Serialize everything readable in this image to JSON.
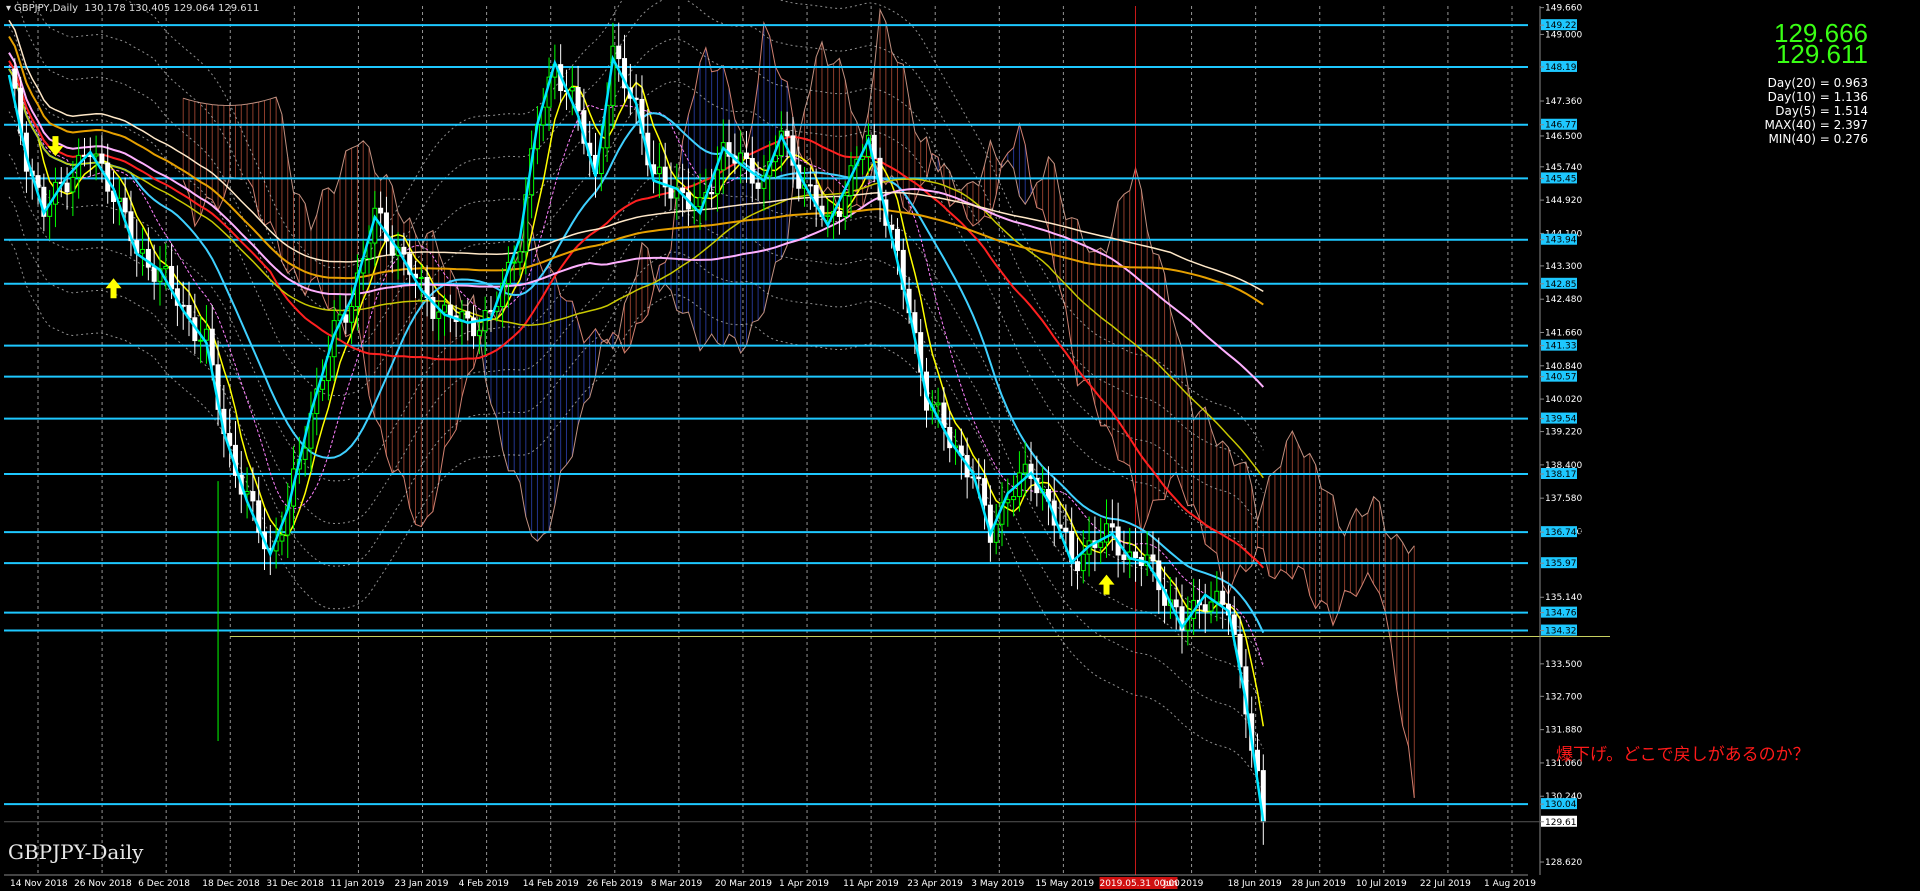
{
  "header": {
    "symbol": "GBPJPY,Daily",
    "ohlc": "130.178 130.405 129.064 129.611"
  },
  "watermark": "GBPJPY-Daily",
  "prices": {
    "bid": "129.666",
    "ask": "129.611"
  },
  "stats": [
    "Day(20) = 0.963",
    "Day(10) = 1.136",
    "Day(5) = 1.514",
    "MAX(40) = 2.397",
    "MIN(40) = 0.276"
  ],
  "annotation": "爆下げ。どこで戻しがあるのか？",
  "colors": {
    "background": "#000000",
    "hline": "#1ec8ff",
    "bull_candle": "#00ff00",
    "bear_candle": "#ffffff",
    "zigzag": "#00e5ff",
    "ma_fast": "#ffff00",
    "ma_red": "#ff2020",
    "ma_cyan": "#3fd0ff",
    "ma_orange": "#e6a000",
    "ma_pink": "#ffb0ff",
    "ma_white": "#ffe8c8",
    "kumo_bear": "#ff7050",
    "kumo_bull": "#4060ff",
    "current_price": "#ffffff",
    "note": "#ff1a1a"
  },
  "chart_data": {
    "type": "candlestick",
    "symbol": "GBPJPY",
    "timeframe": "Daily",
    "ylim": [
      128.3,
      149.7
    ],
    "y_ticks": [
      "149.660",
      "149.228",
      "149.000",
      "148.199",
      "147.360",
      "146.776",
      "146.500",
      "145.740",
      "145.454",
      "144.920",
      "144.100",
      "143.944",
      "143.300",
      "142.859",
      "142.480",
      "141.660",
      "141.336",
      "140.840",
      "140.572",
      "140.020",
      "139.540",
      "139.220",
      "138.400",
      "138.175",
      "137.580",
      "136.760",
      "136.743",
      "135.979",
      "135.140",
      "134.761",
      "134.320",
      "133.500",
      "132.700",
      "131.880",
      "131.060",
      "130.240",
      "130.045",
      "129.611",
      "128.620"
    ],
    "x_ticks": [
      "14 Nov 2018",
      "26 Nov 2018",
      "6 Dec 2018",
      "18 Dec 2018",
      "31 Dec 2018",
      "11 Jan 2019",
      "23 Jan 2019",
      "4 Feb 2019",
      "14 Feb 2019",
      "26 Feb 2019",
      "8 Mar 2019",
      "20 Mar 2019",
      "1 Apr 2019",
      "11 Apr 2019",
      "23 Apr 2019",
      "3 May 2019",
      "15 May 2019",
      "2019.05.31 00:00",
      "Jun 2019",
      "18 Jun 2019",
      "28 Jun 2019",
      "10 Jul 2019",
      "22 Jul 2019",
      "1 Aug 2019"
    ],
    "highlighted_x_tick": "2019.05.31 00:00",
    "horizontal_levels": [
      149.228,
      148.199,
      146.776,
      145.454,
      143.944,
      142.859,
      141.336,
      140.572,
      139.54,
      138.175,
      136.743,
      135.979,
      134.761,
      134.32,
      130.045
    ],
    "current_price": 129.611,
    "price_path": [
      [
        0,
        148.0
      ],
      [
        3,
        146.0
      ],
      [
        6,
        144.6
      ],
      [
        10,
        145.5
      ],
      [
        14,
        146.1
      ],
      [
        18,
        145.2
      ],
      [
        22,
        143.6
      ],
      [
        26,
        143.2
      ],
      [
        30,
        142.2
      ],
      [
        34,
        141.4
      ],
      [
        37,
        139.2
      ],
      [
        41,
        137.5
      ],
      [
        45,
        136.2
      ],
      [
        48,
        137.3
      ],
      [
        52,
        139.7
      ],
      [
        56,
        141.6
      ],
      [
        59,
        142.5
      ],
      [
        63,
        144.5
      ],
      [
        67,
        143.7
      ],
      [
        71,
        142.7
      ],
      [
        75,
        142.1
      ],
      [
        79,
        141.9
      ],
      [
        83,
        142.0
      ],
      [
        88,
        144.0
      ],
      [
        91,
        146.8
      ],
      [
        94,
        148.3
      ],
      [
        98,
        147.0
      ],
      [
        101,
        145.5
      ],
      [
        104,
        148.4
      ],
      [
        108,
        147.3
      ],
      [
        111,
        145.4
      ],
      [
        115,
        145.2
      ],
      [
        119,
        144.6
      ],
      [
        123,
        146.2
      ],
      [
        126,
        145.8
      ],
      [
        130,
        145.4
      ],
      [
        133,
        146.5
      ],
      [
        137,
        145.3
      ],
      [
        141,
        144.3
      ],
      [
        144,
        145.2
      ],
      [
        148,
        146.4
      ],
      [
        151,
        144.6
      ],
      [
        155,
        142.2
      ],
      [
        158,
        140.1
      ],
      [
        162,
        139.0
      ],
      [
        166,
        138.2
      ],
      [
        169,
        136.7
      ],
      [
        172,
        137.7
      ],
      [
        176,
        138.2
      ],
      [
        179,
        137.5
      ],
      [
        183,
        136.0
      ],
      [
        186,
        136.4
      ],
      [
        190,
        136.7
      ],
      [
        193,
        136.1
      ],
      [
        196,
        136.0
      ],
      [
        199,
        135.3
      ],
      [
        202,
        134.4
      ],
      [
        206,
        135.2
      ],
      [
        210,
        134.8
      ],
      [
        213,
        132.6
      ],
      [
        216,
        129.611
      ]
    ],
    "arrows": [
      {
        "type": "down",
        "index": 8,
        "price": 146.2
      },
      {
        "type": "up",
        "index": 18,
        "price": 142.8
      },
      {
        "type": "up",
        "index": 189,
        "price": 135.5
      }
    ]
  }
}
